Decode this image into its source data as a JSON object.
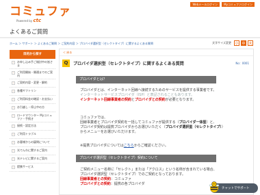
{
  "header": {
    "logo_text": "コミュファ",
    "logo_sub_prefix": "Powered by",
    "logo_sub_brand": "ctc",
    "links": [
      "Webメールログイン",
      "Myコミュファログイン"
    ],
    "page_title": "よくあるご質問"
  },
  "breadcrumb": "ホーム ＞ サポート ＞ よくあるご質問 ＞ ご契約内容 ＞ プロバイダ選択型（セレクトタイプ）に関するよくある質問",
  "fontsize": {
    "label": "文字サイズ変更",
    "options": [
      "小",
      "中",
      "大"
    ]
  },
  "sidebar": {
    "heading": "目的から探す",
    "items": [
      "お申し込み手ご検討中の皆さま",
      "ご利用開始・開通までのご案内",
      "ご契約内容・変更・解約",
      "各種ギフトリン",
      "ご利用料金の確認・お支払い",
      "お引越し・停止中の方",
      "ロードマウンター Myコミュファ・手続き",
      "接続・設定方法",
      "ご利用トラブル",
      "お客様からの疑問について",
      "光でんわに関するご案内",
      "光テレビに関するご案内",
      "提携サービス"
    ]
  },
  "main": {
    "back": "＜ 戻る",
    "q_badge": "Q",
    "q_title": "プロバイダ選択型（セレクトタイプ）に関するよくある質問",
    "q_meta": "No：0001",
    "section1": "プロバイダとは？",
    "p1_line1": "プロバイダとは、インターネット回線へ接続するためのサービスを提供する事業者です。",
    "p1_line2": "インターネットサービスプロバイダ（ISP）と表記されることもあります。",
    "p1_line3_a": "インターネット回線事業者の契約",
    "p1_line3_b": "と",
    "p1_line3_c": "プロバイダとの契約",
    "p1_line3_d": "が必要となります。",
    "p2_line1": "コミュファでは、",
    "p2_line2_a": "回線事業者とプロバイダ契約を一括してコミュファが提供する（",
    "p2_line2_b": "プロバイダ一体型",
    "p2_line2_c": "）と、",
    "p2_line3_a": "プロバイダ契約は提携プロバイダからお選びいただく（",
    "p2_line3_b": "プロバイダ選択型（セレクトタイプ）",
    "p2_line3_c": "）",
    "p2_line4": "からメニューをお選びいただけます。",
    "p3_a": "※提携プロバイダについては",
    "p3_link": "こちら",
    "p3_b": "からご確認ください。",
    "section2": "プロバイダ選択型（セレクトタイプ）契約について",
    "p4_line1": "ご契約メニュー名称に「セレクト」または「アクロス」という名称が含まれている場合、",
    "p4_line2": "プロバイダ選択型（セレクトタイプ）でのご契約となっております。",
    "p4_line3_a": "回線事業者との契約",
    "p4_line3_b": "：コミュファ",
    "p4_line4_a": "プロバイダとの契約",
    "p4_line4_b": "：提携の各プロバイダ"
  },
  "chat": {
    "label": "チャットでサポート"
  }
}
